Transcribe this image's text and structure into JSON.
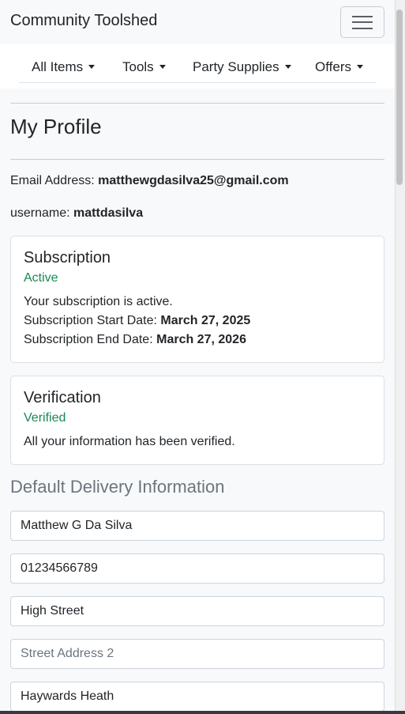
{
  "navbar": {
    "brand": "Community Toolshed",
    "toggler_icon": "hamburger-icon"
  },
  "menu": {
    "items": [
      {
        "label": "All Items"
      },
      {
        "label": "Tools"
      },
      {
        "label": "Party Supplies"
      },
      {
        "label": "Offers"
      }
    ]
  },
  "profile": {
    "title": "My Profile",
    "email_label": "Email Address:",
    "email": "matthewgdasilva25@gmail.com",
    "username_label": "username:",
    "username": "mattdasilva"
  },
  "subscription": {
    "title": "Subscription",
    "status": "Active",
    "message": "Your subscription is active.",
    "start_label": "Subscription Start Date:",
    "start_date": "March 27, 2025",
    "end_label": "Subscription End Date:",
    "end_date": "March 27, 2026"
  },
  "verification": {
    "title": "Verification",
    "status": "Verified",
    "message": "All your information has been verified."
  },
  "delivery": {
    "heading": "Default Delivery Information",
    "full_name": "Matthew G Da Silva",
    "phone": "01234566789",
    "street1": "High Street",
    "street2_placeholder": "Street Address 2",
    "town": "Haywards Heath"
  },
  "colors": {
    "status_green": "#198754",
    "muted_heading": "#6c757d"
  }
}
